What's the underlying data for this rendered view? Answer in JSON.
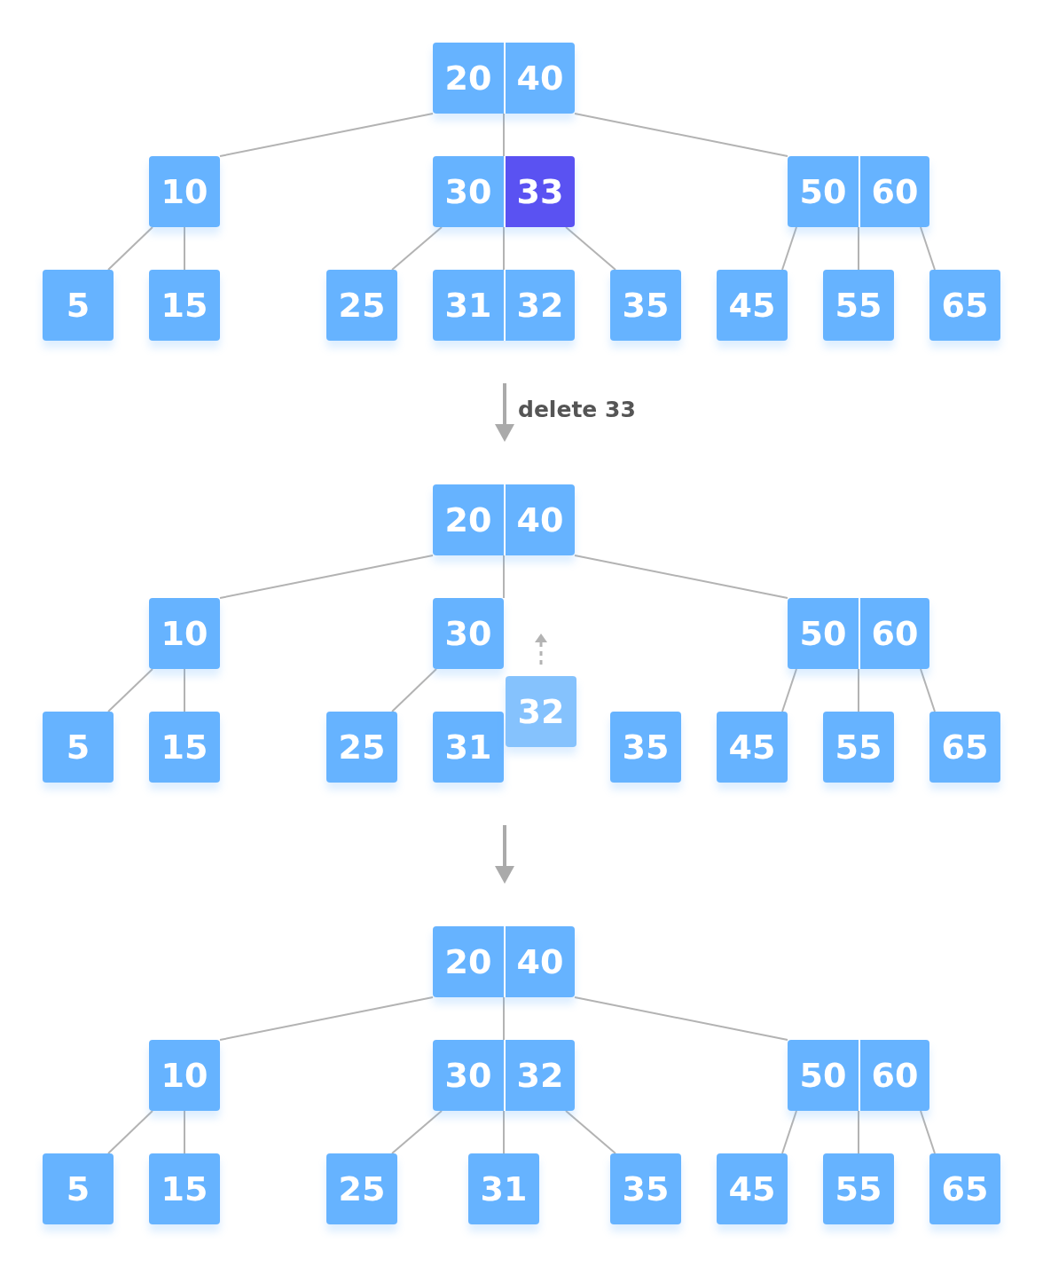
{
  "steps": [
    {
      "tree": {
        "keys": [
          {
            "text": "20",
            "kind": "normal"
          },
          {
            "text": "40",
            "kind": "normal"
          }
        ],
        "children": [
          {
            "linked": true,
            "keys": [
              {
                "text": "10",
                "kind": "normal"
              }
            ],
            "children": [
              {
                "linked": true,
                "keys": [
                  {
                    "text": "5",
                    "kind": "normal"
                  }
                ]
              },
              {
                "linked": true,
                "keys": [
                  {
                    "text": "15",
                    "kind": "normal"
                  }
                ]
              }
            ]
          },
          {
            "linked": true,
            "keys": [
              {
                "text": "30",
                "kind": "normal"
              },
              {
                "text": "33",
                "kind": "target"
              }
            ],
            "children": [
              {
                "linked": true,
                "keys": [
                  {
                    "text": "25",
                    "kind": "normal"
                  }
                ]
              },
              {
                "linked": true,
                "keys": [
                  {
                    "text": "31",
                    "kind": "normal"
                  },
                  {
                    "text": "32",
                    "kind": "normal"
                  }
                ]
              },
              {
                "linked": true,
                "keys": [
                  {
                    "text": "35",
                    "kind": "normal"
                  }
                ]
              }
            ]
          },
          {
            "linked": true,
            "keys": [
              {
                "text": "50",
                "kind": "normal"
              },
              {
                "text": "60",
                "kind": "normal"
              }
            ],
            "children": [
              {
                "linked": true,
                "keys": [
                  {
                    "text": "45",
                    "kind": "normal"
                  }
                ]
              },
              {
                "linked": true,
                "keys": [
                  {
                    "text": "55",
                    "kind": "normal"
                  }
                ]
              },
              {
                "linked": true,
                "keys": [
                  {
                    "text": "65",
                    "kind": "normal"
                  }
                ]
              }
            ]
          }
        ]
      }
    },
    {
      "caption": "delete 33",
      "tree": {
        "keys": [
          {
            "text": "20",
            "kind": "normal"
          },
          {
            "text": "40",
            "kind": "normal"
          }
        ],
        "children": [
          {
            "linked": true,
            "keys": [
              {
                "text": "10",
                "kind": "normal"
              }
            ],
            "children": [
              {
                "linked": true,
                "keys": [
                  {
                    "text": "5",
                    "kind": "normal"
                  }
                ]
              },
              {
                "linked": true,
                "keys": [
                  {
                    "text": "15",
                    "kind": "normal"
                  }
                ]
              }
            ]
          },
          {
            "linked": true,
            "keys": [
              {
                "text": "30",
                "kind": "normal"
              }
            ],
            "children": [
              {
                "linked": true,
                "keys": [
                  {
                    "text": "25",
                    "kind": "normal"
                  }
                ]
              },
              {
                "linked": false,
                "keys": [
                  {
                    "text": "31",
                    "kind": "normal"
                  }
                ]
              },
              {
                "linked": false,
                "keys": [
                  {
                    "text": "32",
                    "kind": "moving"
                  }
                ]
              },
              {
                "linked": false,
                "keys": [
                  {
                    "text": "35",
                    "kind": "normal"
                  }
                ]
              }
            ]
          },
          {
            "linked": true,
            "keys": [
              {
                "text": "50",
                "kind": "normal"
              },
              {
                "text": "60",
                "kind": "normal"
              }
            ],
            "children": [
              {
                "linked": true,
                "keys": [
                  {
                    "text": "45",
                    "kind": "normal"
                  }
                ]
              },
              {
                "linked": true,
                "keys": [
                  {
                    "text": "55",
                    "kind": "normal"
                  }
                ]
              },
              {
                "linked": true,
                "keys": [
                  {
                    "text": "65",
                    "kind": "normal"
                  }
                ]
              }
            ]
          }
        ]
      }
    },
    {
      "tree": {
        "keys": [
          {
            "text": "20",
            "kind": "normal"
          },
          {
            "text": "40",
            "kind": "normal"
          }
        ],
        "children": [
          {
            "linked": true,
            "keys": [
              {
                "text": "10",
                "kind": "normal"
              }
            ],
            "children": [
              {
                "linked": true,
                "keys": [
                  {
                    "text": "5",
                    "kind": "normal"
                  }
                ]
              },
              {
                "linked": true,
                "keys": [
                  {
                    "text": "15",
                    "kind": "normal"
                  }
                ]
              }
            ]
          },
          {
            "linked": true,
            "keys": [
              {
                "text": "30",
                "kind": "normal"
              },
              {
                "text": "32",
                "kind": "normal"
              }
            ],
            "children": [
              {
                "linked": true,
                "keys": [
                  {
                    "text": "25",
                    "kind": "normal"
                  }
                ]
              },
              {
                "linked": true,
                "keys": [
                  {
                    "text": "31",
                    "kind": "normal"
                  }
                ]
              },
              {
                "linked": true,
                "keys": [
                  {
                    "text": "35",
                    "kind": "normal"
                  }
                ]
              }
            ]
          },
          {
            "linked": true,
            "keys": [
              {
                "text": "50",
                "kind": "normal"
              },
              {
                "text": "60",
                "kind": "normal"
              }
            ],
            "children": [
              {
                "linked": true,
                "keys": [
                  {
                    "text": "45",
                    "kind": "normal"
                  }
                ]
              },
              {
                "linked": true,
                "keys": [
                  {
                    "text": "55",
                    "kind": "normal"
                  }
                ]
              },
              {
                "linked": true,
                "keys": [
                  {
                    "text": "65",
                    "kind": "normal"
                  }
                ]
              }
            ]
          }
        ]
      }
    }
  ]
}
